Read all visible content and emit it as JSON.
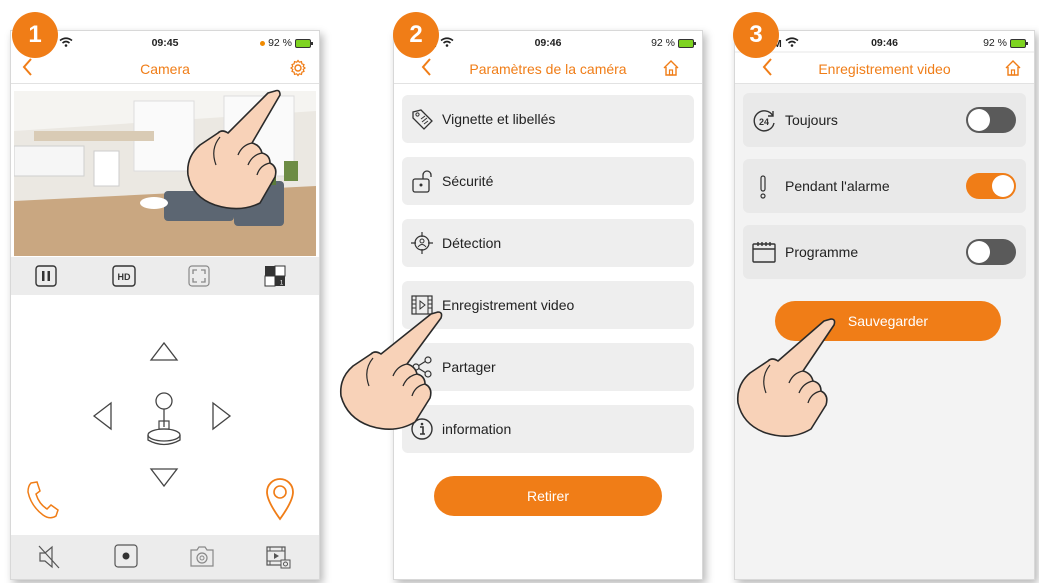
{
  "steps": [
    "1",
    "2",
    "3"
  ],
  "colors": {
    "accent": "#f07d17",
    "toggle_off": "#5a5a5a",
    "battery": "#7ed321"
  },
  "screen1": {
    "status": {
      "carrier_fragment": "",
      "time": "09:45",
      "battery": "92 %"
    },
    "title": "Camera",
    "icons": [
      "back-chevron-icon",
      "gear-icon",
      "pause-icon",
      "hd-icon",
      "fullscreen-icon",
      "multiview-icon",
      "arrow-up-icon",
      "arrow-left-icon",
      "joystick-icon",
      "arrow-right-icon",
      "arrow-down-icon",
      "phone-icon",
      "location-pin-icon",
      "mute-icon",
      "record-icon",
      "snapshot-icon",
      "gallery-icon"
    ],
    "hd_label": "HD",
    "multiview_label": "1"
  },
  "screen2": {
    "status": {
      "carrier_fragment": "M",
      "time": "09:46",
      "battery": "92 %"
    },
    "title": "Paramètres de la caméra",
    "items": [
      {
        "label": "Vignette et libellés",
        "icon": "tag-icon"
      },
      {
        "label": "Sécurité",
        "icon": "padlock-icon"
      },
      {
        "label": "Détection",
        "icon": "detection-icon"
      },
      {
        "label": "Enregistrement video",
        "icon": "film-icon"
      },
      {
        "label": "Partager",
        "icon": "share-icon"
      },
      {
        "label": "information",
        "icon": "info-icon"
      }
    ],
    "button": "Retirer"
  },
  "screen3": {
    "status": {
      "carrier_fragment": "M",
      "time": "09:46",
      "battery": "92 %"
    },
    "title": "Enregistrement video",
    "options": [
      {
        "label": "Toujours",
        "icon": "clock-24-icon",
        "on": false
      },
      {
        "label": "Pendant l'alarme",
        "icon": "exclamation-icon",
        "on": true
      },
      {
        "label": "Programme",
        "icon": "calendar-icon",
        "on": false
      }
    ],
    "button": "Sauvegarder"
  }
}
